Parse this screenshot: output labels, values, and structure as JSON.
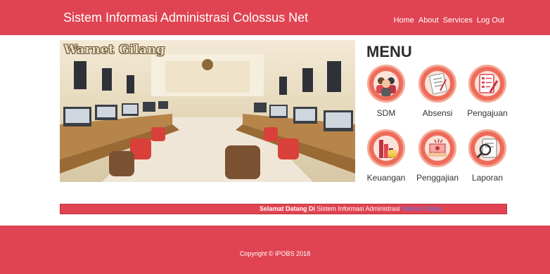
{
  "header": {
    "title": "Sistem Informasi Administrasi Colossus Net",
    "nav": [
      "Home",
      "About",
      "Services",
      "Log Out"
    ]
  },
  "hero": {
    "logo_text": "Warnet Gilang"
  },
  "menu": {
    "title": "MENU",
    "items": [
      {
        "label": "SDM",
        "icon": "people-icon"
      },
      {
        "label": "Absensi",
        "icon": "attendance-document-icon"
      },
      {
        "label": "Pengajuan",
        "icon": "form-pen-icon"
      },
      {
        "label": "Keuangan",
        "icon": "coins-chart-icon"
      },
      {
        "label": "Penggajian",
        "icon": "cash-hand-icon"
      },
      {
        "label": "Laporan",
        "icon": "report-magnifier-icon"
      }
    ]
  },
  "welcome": {
    "bold": "Selamat Datang Di",
    "text": " Sistem Informasi Administrasi ",
    "link": "Warnet Gilang"
  },
  "footer": {
    "copyright": "Copyright © IPOBS 2018"
  },
  "colors": {
    "accent": "#e04452",
    "icon_bg": "#ee6b5a"
  }
}
